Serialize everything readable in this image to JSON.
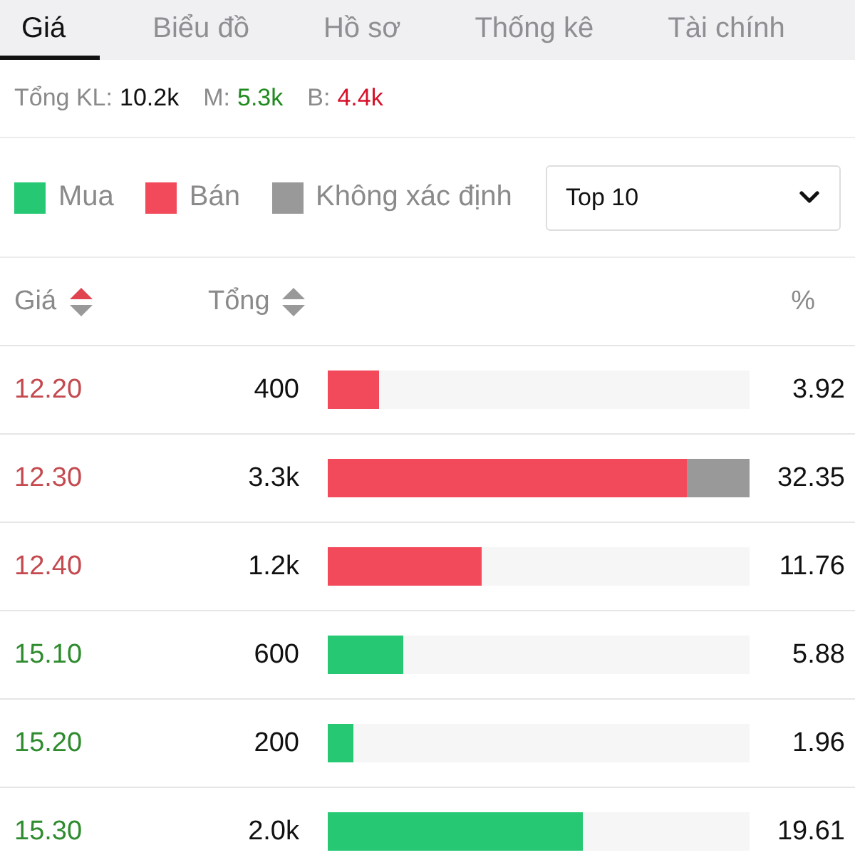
{
  "tabs": [
    {
      "label": "Giá",
      "selected": true
    },
    {
      "label": "Biểu đồ",
      "selected": false
    },
    {
      "label": "Hồ sơ",
      "selected": false
    },
    {
      "label": "Thống kê",
      "selected": false
    },
    {
      "label": "Tài chính",
      "selected": false
    }
  ],
  "summary": [
    {
      "label": "Tổng KL:",
      "value": "10.2k",
      "kind": "total"
    },
    {
      "label": "M:",
      "value": "5.3k",
      "kind": "buy"
    },
    {
      "label": "B:",
      "value": "4.4k",
      "kind": "sell"
    }
  ],
  "legend": [
    {
      "label": "Mua",
      "kind": "buy",
      "color": "#26c873"
    },
    {
      "label": "Bán",
      "kind": "sell",
      "color": "#f24a5b"
    },
    {
      "label": "Không xác định",
      "kind": "unknown",
      "color": "#999999"
    }
  ],
  "dropdown": {
    "value": "Top 10"
  },
  "columns": [
    {
      "label": "Giá",
      "kind": "sortable",
      "sorted_ascending": true
    },
    {
      "label": "Tổng",
      "kind": "sortable",
      "sorted_ascending": false
    },
    {
      "label": "%",
      "kind": "plain"
    }
  ],
  "rows": [
    {
      "price": "12.20",
      "kind": "sell",
      "total": "400",
      "bar": [
        {
          "kind": "sell",
          "level": 0.12
        }
      ],
      "percent": "3.92"
    },
    {
      "price": "12.30",
      "kind": "sell",
      "total": "3.3k",
      "bar": [
        {
          "kind": "sell",
          "level": 0.85
        },
        {
          "kind": "unknown",
          "level": 0.15
        }
      ],
      "percent": "32.35"
    },
    {
      "price": "12.40",
      "kind": "sell",
      "total": "1.2k",
      "bar": [
        {
          "kind": "sell",
          "level": 0.365
        }
      ],
      "percent": "11.76"
    },
    {
      "price": "15.10",
      "kind": "buy",
      "total": "600",
      "bar": [
        {
          "kind": "buy",
          "level": 0.18
        }
      ],
      "percent": "5.88"
    },
    {
      "price": "15.20",
      "kind": "buy",
      "total": "200",
      "bar": [
        {
          "kind": "buy",
          "level": 0.06
        }
      ],
      "percent": "1.96"
    },
    {
      "price": "15.30",
      "kind": "buy",
      "total": "2.0k",
      "bar": [
        {
          "kind": "buy",
          "level": 0.605
        }
      ],
      "percent": "19.61"
    }
  ]
}
